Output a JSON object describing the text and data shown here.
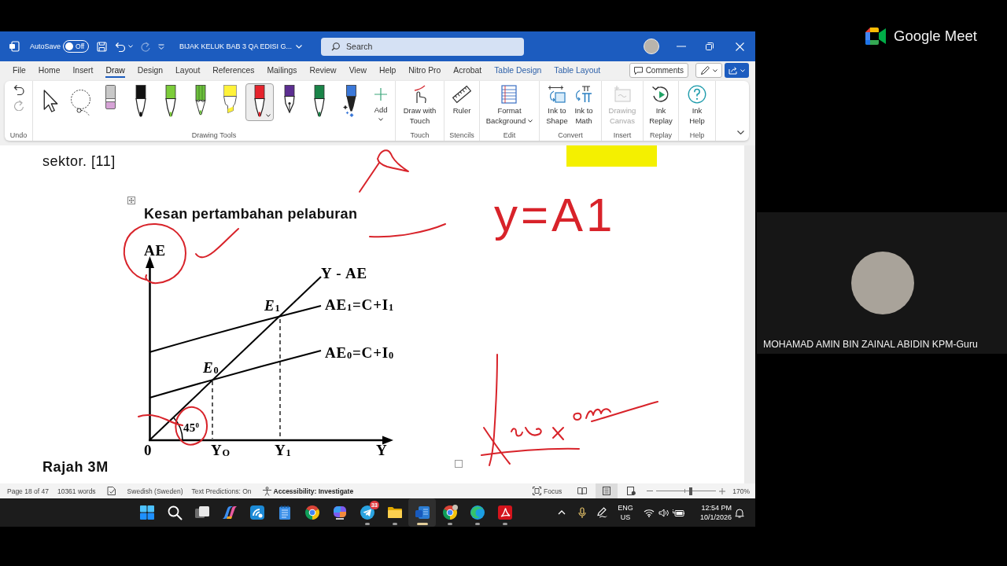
{
  "title_bar": {
    "autosave_label": "AutoSave",
    "autosave": {
      "on": false,
      "state": "Off"
    },
    "quick_access": [
      {
        "kind": "save",
        "disabled": false
      },
      {
        "kind": "undo",
        "disabled": false
      },
      {
        "kind": "redo",
        "disabled": true
      },
      {
        "kind": "customize",
        "disabled": false
      }
    ],
    "document_title": "BIJAK KELUK BAB 3 QA EDISI G...",
    "search": {
      "placeholder": "Search"
    }
  },
  "menu_tabs": [
    {
      "label": "File",
      "selected": false,
      "contextual": false
    },
    {
      "label": "Home",
      "selected": false,
      "contextual": false
    },
    {
      "label": "Insert",
      "selected": false,
      "contextual": false
    },
    {
      "label": "Draw",
      "selected": true,
      "contextual": false
    },
    {
      "label": "Design",
      "selected": false,
      "contextual": false
    },
    {
      "label": "Layout",
      "selected": false,
      "contextual": false
    },
    {
      "label": "References",
      "selected": false,
      "contextual": false
    },
    {
      "label": "Mailings",
      "selected": false,
      "contextual": false
    },
    {
      "label": "Review",
      "selected": false,
      "contextual": false
    },
    {
      "label": "View",
      "selected": false,
      "contextual": false
    },
    {
      "label": "Help",
      "selected": false,
      "contextual": false
    },
    {
      "label": "Nitro Pro",
      "selected": false,
      "contextual": false
    },
    {
      "label": "Acrobat",
      "selected": false,
      "contextual": false
    },
    {
      "label": "Table Design",
      "selected": false,
      "contextual": true
    },
    {
      "label": "Table Layout",
      "selected": false,
      "contextual": true
    }
  ],
  "menu_actions": {
    "comments": "Comments"
  },
  "ribbon": {
    "groups": [
      {
        "label": "Undo",
        "kind": "history",
        "items": [
          {
            "kind": "undo",
            "disabled": false
          },
          {
            "kind": "redo",
            "disabled": true
          }
        ]
      },
      {
        "label": "Drawing Tools",
        "kind": "tools",
        "tools": [
          {
            "kind": "select",
            "selected": false
          },
          {
            "kind": "lasso",
            "selected": false
          },
          {
            "kind": "eraser",
            "selected": false
          },
          {
            "kind": "pen",
            "color": "#111111",
            "selected": false
          },
          {
            "kind": "pen",
            "color": "#7ccc3a",
            "selected": false
          },
          {
            "kind": "pencil",
            "color": "#6cbf3c",
            "selected": false
          },
          {
            "kind": "highlighter",
            "color": "#fff23a",
            "selected": false
          },
          {
            "kind": "pen",
            "color": "#e5232c",
            "selected": true
          },
          {
            "kind": "fountain_pen",
            "color": "#5c2e91",
            "selected": false
          },
          {
            "kind": "pen",
            "color": "#1a8448",
            "selected": false
          },
          {
            "kind": "action_pen",
            "color": "#3b78d8",
            "selected": false
          }
        ],
        "add": "Add"
      },
      {
        "label": "Touch",
        "kind": "buttons",
        "items": [
          {
            "kind": "touch",
            "label": "Draw with\nTouch",
            "disabled": false,
            "dropdown": false
          }
        ]
      },
      {
        "label": "Stencils",
        "kind": "buttons",
        "items": [
          {
            "kind": "ruler",
            "label": "Ruler",
            "disabled": false,
            "dropdown": false
          }
        ]
      },
      {
        "label": "Edit",
        "kind": "buttons",
        "items": [
          {
            "kind": "background",
            "label": "Format\nBackground",
            "disabled": false,
            "dropdown": true
          }
        ]
      },
      {
        "label": "Convert",
        "kind": "buttons",
        "items": [
          {
            "kind": "shape",
            "label": "Ink to\nShape",
            "disabled": false,
            "dropdown": false
          },
          {
            "kind": "math",
            "label": "Ink to\nMath",
            "disabled": false,
            "dropdown": false
          }
        ]
      },
      {
        "label": "Insert",
        "kind": "buttons",
        "items": [
          {
            "kind": "canvas",
            "label": "Drawing\nCanvas",
            "disabled": true,
            "dropdown": false
          }
        ]
      },
      {
        "label": "Replay",
        "kind": "buttons",
        "items": [
          {
            "kind": "replay",
            "label": "Ink\nReplay",
            "disabled": false,
            "dropdown": false
          }
        ]
      },
      {
        "label": "Help",
        "kind": "buttons",
        "items": [
          {
            "kind": "help",
            "label": "Ink\nHelp",
            "disabled": false,
            "dropdown": false
          }
        ]
      }
    ]
  },
  "document": {
    "paragraph": "sektor. [11]",
    "figure": {
      "title": "Kesan pertambahan pelaburan",
      "labels": {
        "y_axis": "AE",
        "line_45": "Y - AE",
        "point_e1": "E$_{1}$",
        "line_ae1": "AE$_{1}$=C+I$_{1}$",
        "point_e0": "E$_{0}$",
        "line_ae0": "AE$_{0}$=C+I$_{0}$",
        "angle": "45$^{0}$",
        "origin": "0",
        "income_y0": "Y$_{O}$",
        "income_y1": "Y$_{1}$",
        "x_axis": "Y"
      }
    },
    "handwriting": "y=A1",
    "caption": "Rajah 3M"
  },
  "status_bar": {
    "page": "Page 18 of 47",
    "words": "10361 words",
    "language": "Swedish (Sweden)",
    "predictions": "Text Predictions: On",
    "accessibility": "Accessibility: Investigate",
    "focus": "Focus",
    "views": [
      {
        "kind": "read",
        "selected": false
      },
      {
        "kind": "print",
        "selected": true
      },
      {
        "kind": "web",
        "selected": false
      }
    ],
    "zoom": {
      "level": 0.57,
      "value": "170%"
    }
  },
  "taskbar": {
    "apps": [
      {
        "kind": "start",
        "running": false,
        "active": false
      },
      {
        "kind": "search",
        "running": false,
        "active": false
      },
      {
        "kind": "task_view",
        "running": false,
        "active": false
      },
      {
        "kind": "copilot",
        "running": false,
        "active": false
      },
      {
        "kind": "wave_app",
        "running": false,
        "active": false
      },
      {
        "kind": "notepad",
        "running": false,
        "active": false
      },
      {
        "kind": "chrome",
        "running": false,
        "active": false
      },
      {
        "kind": "m365",
        "running": false,
        "active": false
      },
      {
        "kind": "telegram",
        "running": true,
        "active": false,
        "badge": "33"
      },
      {
        "kind": "explorer",
        "running": true,
        "active": false
      },
      {
        "kind": "word",
        "running": true,
        "active": true
      },
      {
        "kind": "chrome_profile",
        "running": true,
        "active": false
      },
      {
        "kind": "edge",
        "running": true,
        "active": false
      },
      {
        "kind": "acrobat",
        "running": true,
        "active": false
      }
    ],
    "tray": {
      "language": "ENG",
      "region": "US",
      "time": "12:54 PM",
      "date": "10/1/2026"
    }
  },
  "meet": {
    "brand": "Google Meet",
    "participant": "MOHAMAD AMIN BIN ZAINAL ABIDIN KPM-Guru"
  }
}
